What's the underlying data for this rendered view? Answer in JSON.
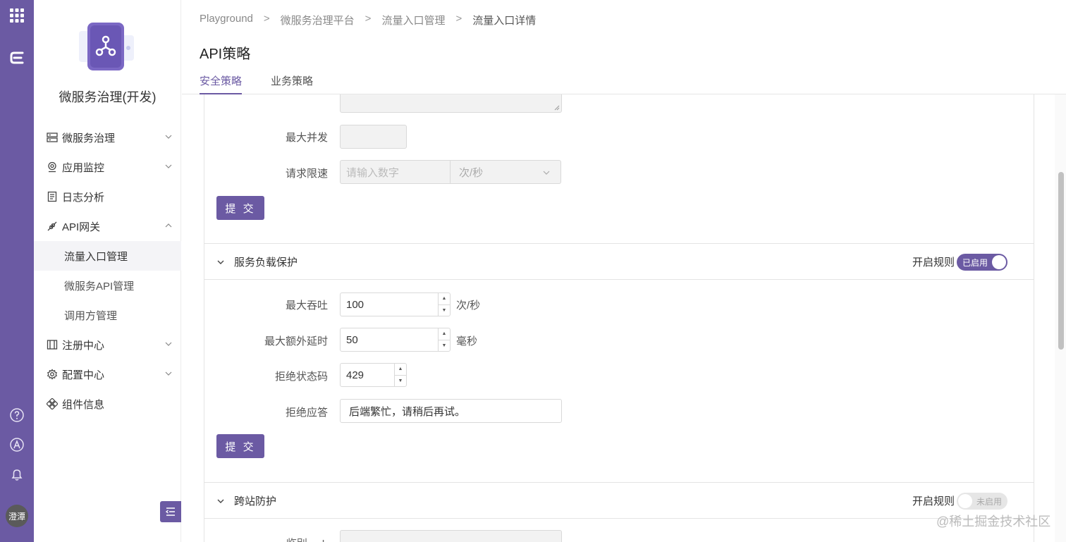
{
  "sidebar": {
    "app_name": "微服务治理(开发)",
    "items": [
      {
        "label": "微服务治理",
        "icon": "server-icon"
      },
      {
        "label": "应用监控",
        "icon": "location-pin-icon"
      },
      {
        "label": "日志分析",
        "icon": "document-icon"
      },
      {
        "label": "API网关",
        "icon": "plug-icon"
      },
      {
        "label": "注册中心",
        "icon": "book-icon"
      },
      {
        "label": "配置中心",
        "icon": "gear-icon"
      },
      {
        "label": "组件信息",
        "icon": "components-icon"
      }
    ],
    "subitems": [
      "流量入口管理",
      "微服务API管理",
      "调用方管理"
    ]
  },
  "rail": {
    "avatar_text": "澄潭"
  },
  "breadcrumb": [
    "Playground",
    "微服务治理平台",
    "流量入口管理",
    "流量入口详情"
  ],
  "page_title": "API策略",
  "tabs": [
    {
      "label": "安全策略",
      "active": true
    },
    {
      "label": "业务策略",
      "active": false
    }
  ],
  "section1": {
    "max_concurrency_label": "最大并发",
    "rate_limit_label": "请求限速",
    "rate_limit_placeholder": "请输入数字",
    "rate_unit_select": "次/秒",
    "submit_label": "提 交"
  },
  "section2": {
    "title": "服务负载保护",
    "rule_label": "开启规则",
    "toggle_text": "已启用",
    "max_throughput_label": "最大吞吐",
    "max_throughput_value": "100",
    "max_throughput_unit": "次/秒",
    "max_extra_delay_label": "最大额外延时",
    "max_extra_delay_value": "50",
    "max_extra_delay_unit": "毫秒",
    "reject_status_label": "拒绝状态码",
    "reject_status_value": "429",
    "reject_response_label": "拒绝应答",
    "reject_response_value": "后端繁忙，请稍后再试。",
    "submit_label": "提 交"
  },
  "section3": {
    "title": "跨站防护",
    "rule_label": "开启规则",
    "toggle_text": "未启用",
    "partial_label": "临别 ... L"
  },
  "watermark": "@稀土掘金技术社区",
  "colors": {
    "accent": "#6b5aa3",
    "rail": "#6b5aa3"
  }
}
